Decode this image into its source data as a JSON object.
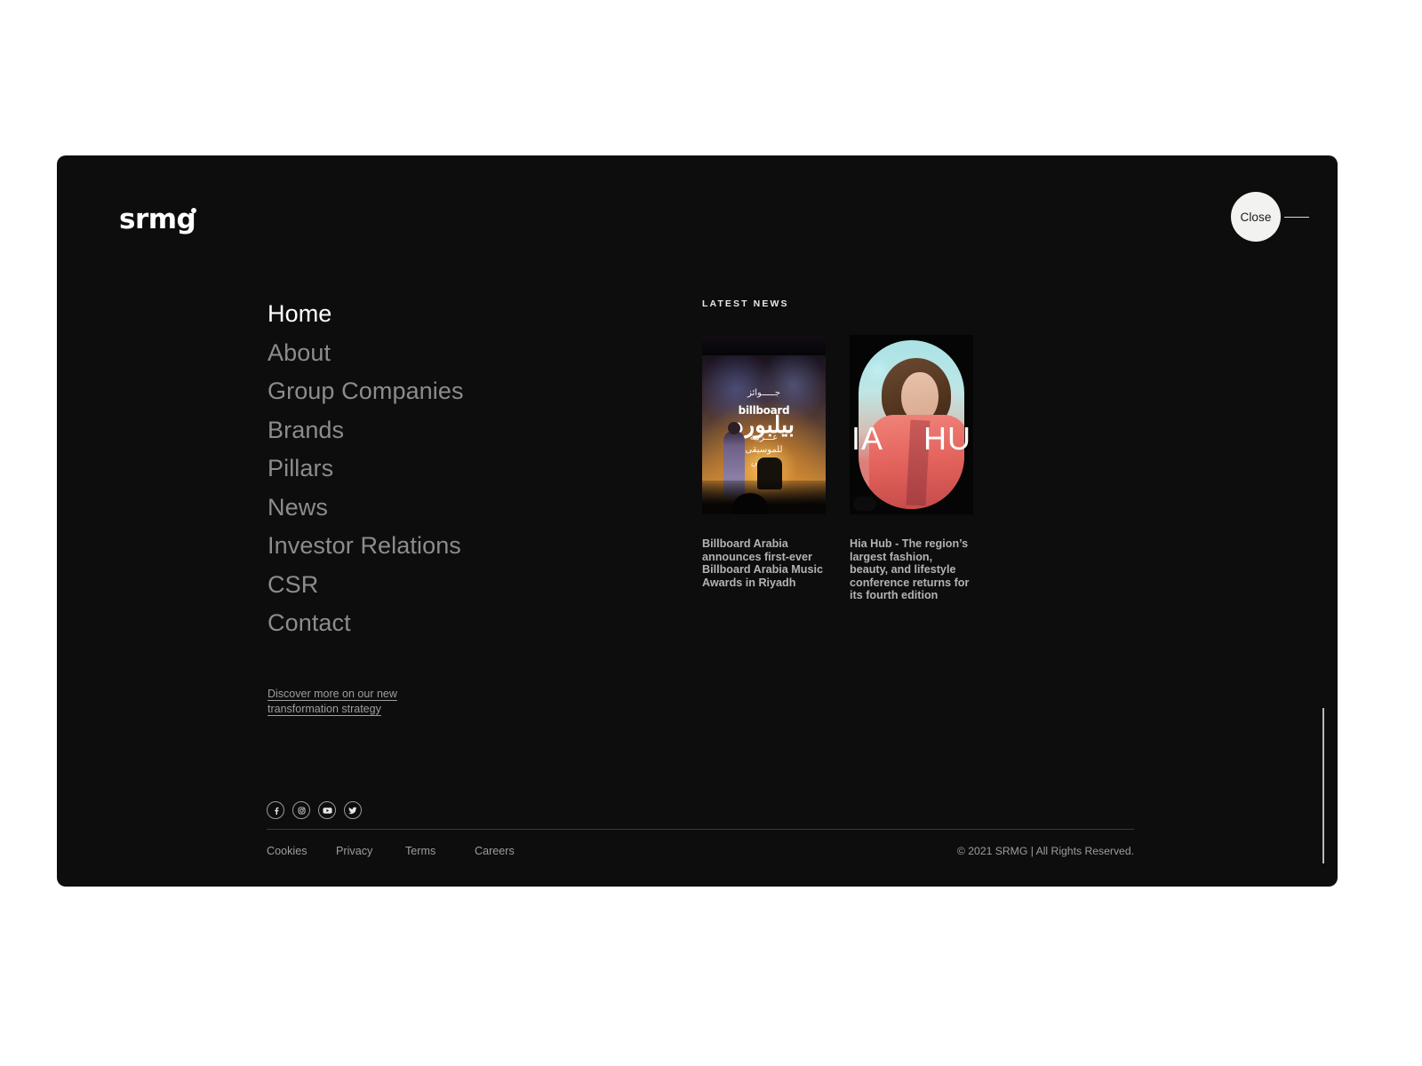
{
  "brand": {
    "logo_text": "srmg"
  },
  "header": {
    "close_label": "Close"
  },
  "nav": {
    "items": [
      {
        "label": "Home",
        "active": true
      },
      {
        "label": "About",
        "active": false
      },
      {
        "label": "Group Companies",
        "active": false
      },
      {
        "label": "Brands",
        "active": false
      },
      {
        "label": "Pillars",
        "active": false
      },
      {
        "label": "News",
        "active": false
      },
      {
        "label": "Investor Relations",
        "active": false
      },
      {
        "label": "CSR",
        "active": false
      },
      {
        "label": "Contact",
        "active": false
      }
    ]
  },
  "strategy": {
    "link_text": "Discover more on our new transformation strategy"
  },
  "news": {
    "label": "LATEST NEWS",
    "cards": [
      {
        "title": "Billboard Arabia announces first-ever Billboard Arabia Music Awards in Riyadh",
        "image_alt": "Billboard Arabia concert stage",
        "image_text_en": "billboard",
        "image_text_ar": "بيلبورد",
        "image_line1": "جـــــوائز",
        "image_line2": "عـــربية",
        "image_line3": "للموسيقى",
        "image_line4": "الرياض"
      },
      {
        "title": "Hia Hub - The region’s largest fashion, beauty, and lifestyle conference returns for its fourth edition",
        "image_alt": "Hia Hub fashion model",
        "image_text_left": "IA",
        "image_text_right": "HU"
      }
    ]
  },
  "social": {
    "items": [
      {
        "name": "facebook",
        "label": "Facebook"
      },
      {
        "name": "instagram",
        "label": "Instagram"
      },
      {
        "name": "youtube",
        "label": "YouTube"
      },
      {
        "name": "twitter",
        "label": "Twitter"
      }
    ]
  },
  "footer": {
    "links": [
      "Cookies",
      "Privacy",
      "Terms",
      "Careers"
    ],
    "copyright": "© 2021 SRMG | All Rights Reserved."
  },
  "colors": {
    "panel_bg": "#0d0d0d",
    "page_bg": "#ffffff",
    "text_active": "#ffffff",
    "text_muted": "#8c8c8c",
    "close_bg": "#f2f2f0"
  }
}
